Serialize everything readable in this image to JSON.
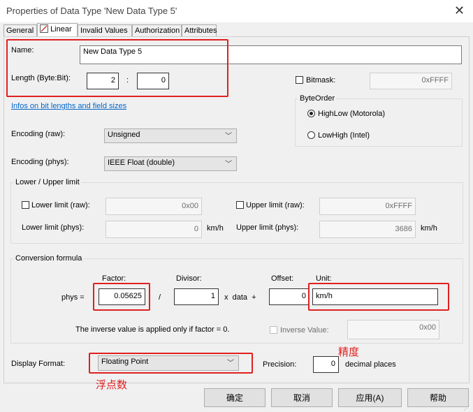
{
  "window": {
    "title": "Properties of Data Type 'New Data Type 5'",
    "close": "✕"
  },
  "tabs": [
    "General",
    "Linear",
    "Invalid Values",
    "Authorization",
    "Attributes"
  ],
  "name": {
    "label": "Name:",
    "value": "New Data Type 5"
  },
  "length": {
    "label": "Length (Byte:Bit):",
    "byte": "2",
    "sep": ":",
    "bit": "0"
  },
  "bitmask": {
    "label": "Bitmask:",
    "value": "0xFFFF"
  },
  "info_link": "Infos on bit lengths and field sizes",
  "byteorder": {
    "title": "ByteOrder",
    "opt1": "HighLow (Motorola)",
    "opt2": "LowHigh (Intel)"
  },
  "encoding_raw": {
    "label": "Encoding (raw):",
    "value": "Unsigned"
  },
  "encoding_phys": {
    "label": "Encoding (phys):",
    "value": "IEEE Float (double)"
  },
  "limits": {
    "title": "Lower / Upper limit",
    "lower_raw_label": "Lower limit (raw):",
    "lower_raw": "0x00",
    "upper_raw_label": "Upper limit (raw):",
    "upper_raw": "0xFFFF",
    "lower_phys_label": "Lower limit (phys):",
    "lower_phys": "0",
    "upper_phys_label": "Upper limit (phys):",
    "upper_phys": "3686",
    "unit": "km/h"
  },
  "conversion": {
    "title": "Conversion formula",
    "phys": "phys =",
    "factor_label": "Factor:",
    "factor": "0.05625",
    "slash": "/",
    "divisor_label": "Divisor:",
    "divisor": "1",
    "xdata": "x  data  +",
    "offset_label": "Offset:",
    "offset": "0",
    "unit_label": "Unit:",
    "unit": "km/h",
    "note": "The inverse value is applied only if factor = 0.",
    "inverse_label": "Inverse Value:",
    "inverse": "0x00"
  },
  "display": {
    "label": "Display Format:",
    "value": "Floating Point",
    "precision_label": "Precision:",
    "precision": "0",
    "suffix": "decimal places"
  },
  "annotations": {
    "precision": "精度",
    "float": "浮点数"
  },
  "buttons": {
    "ok": "确定",
    "cancel": "取消",
    "apply": "应用(A)",
    "help": "帮助"
  },
  "colors": {
    "annotation": "#e02020",
    "link": "#0066cc"
  }
}
